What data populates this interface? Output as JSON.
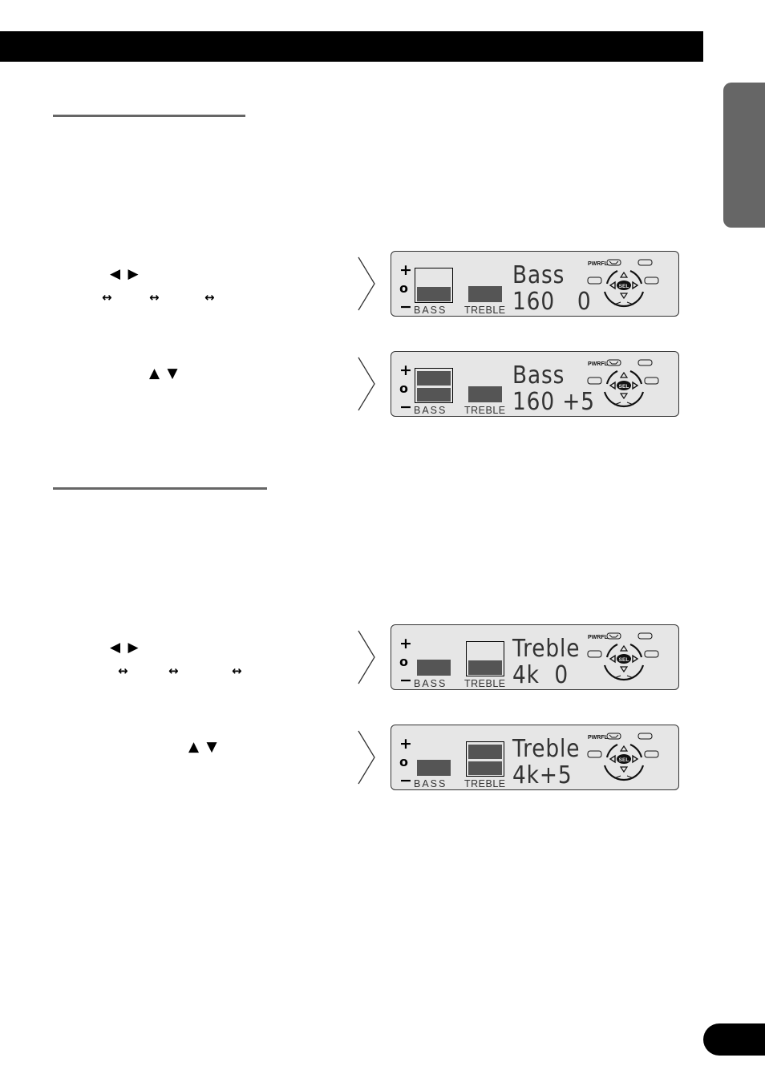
{
  "page": {
    "header_bar": "",
    "side_tab": "",
    "page_number": ""
  },
  "sections": [
    {
      "id": "bass",
      "steps": [
        {
          "select_arrows": "◀ ▶",
          "cycle_arrows": [
            "↔",
            "↔",
            "↔"
          ]
        },
        {
          "adjust_arrows": "▲ ▼"
        }
      ],
      "displays": [
        {
          "title": "Bass",
          "value_line": "160   0",
          "freq": "160",
          "level": "0",
          "bass_level": 0,
          "treble_level": 0,
          "selected": "BASS"
        },
        {
          "title": "Bass",
          "value_line": "160 +5",
          "freq": "160",
          "level": "+5",
          "bass_level": 5,
          "treble_level": 0,
          "selected": "BASS"
        }
      ]
    },
    {
      "id": "treble",
      "steps": [
        {
          "select_arrows": "◀ ▶",
          "cycle_arrows": [
            "↔",
            "↔",
            "↔"
          ]
        },
        {
          "adjust_arrows": "▲ ▼"
        }
      ],
      "displays": [
        {
          "title": "Treble",
          "value_line": "4k  0",
          "freq": "4k",
          "level": "0",
          "bass_level": 0,
          "treble_level": 0,
          "selected": "TREBLE"
        },
        {
          "title": "Treble",
          "value_line": "4k+5",
          "freq": "4k",
          "level": "+5",
          "bass_level": 0,
          "treble_level": 5,
          "selected": "TREBLE"
        }
      ]
    }
  ],
  "lcd_labels": {
    "plus": "+",
    "zero": "o",
    "minus": "−",
    "bass": "BASS",
    "treble": "TREBLE",
    "pwrfl": "PWRFL",
    "sel": "SEL"
  },
  "colors": {
    "lcd_background": "#e6e6e6",
    "bar_fill": "#555555",
    "rule_gray": "#666666",
    "header_black": "#000000"
  }
}
